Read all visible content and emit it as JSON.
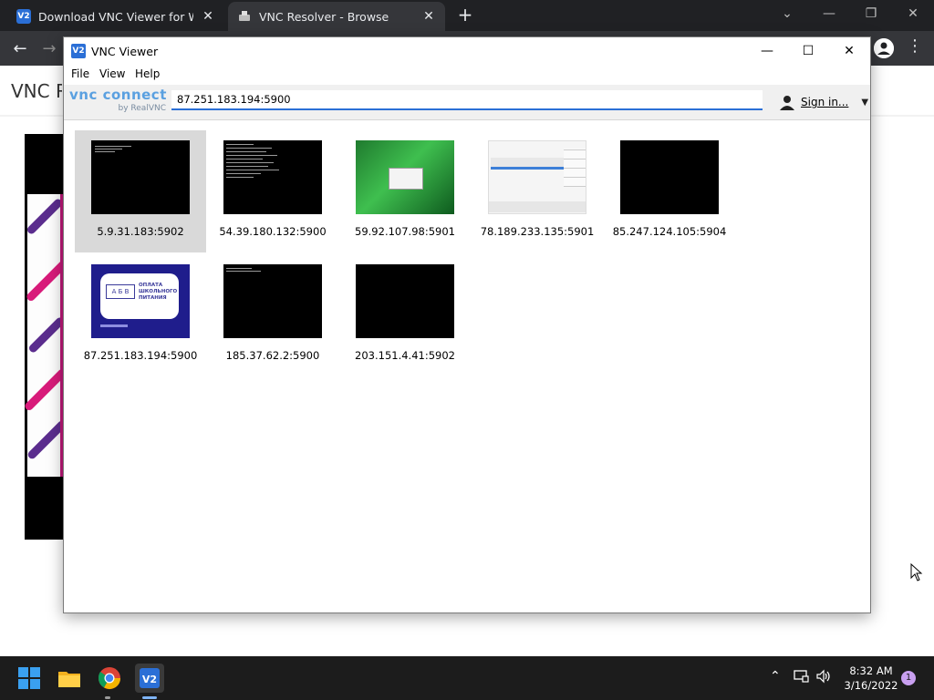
{
  "browser": {
    "tabs": [
      {
        "title": "Download VNC Viewer for Windows",
        "favicon": "vnc-icon",
        "active": false
      },
      {
        "title": "VNC Resolver - Browse",
        "favicon": "resolver-icon",
        "active": true
      }
    ],
    "page_heading": "VNC Resolver"
  },
  "vnc": {
    "window_title": "VNC Viewer",
    "menu": [
      "File",
      "View",
      "Help"
    ],
    "logo_main": "vnc connect",
    "logo_sub": "by RealVNC",
    "address": "87.251.183.194:5900",
    "sign_in": "Sign in...",
    "connections": [
      {
        "label": "5.9.31.183:5902",
        "thumb": "terminal-sparse",
        "selected": true
      },
      {
        "label": "54.39.180.132:5900",
        "thumb": "terminal-dense",
        "selected": false
      },
      {
        "label": "59.92.107.98:5901",
        "thumb": "green-desktop",
        "selected": false
      },
      {
        "label": "78.189.233.135:5901",
        "thumb": "keypad-app",
        "selected": false
      },
      {
        "label": "85.247.124.105:5904",
        "thumb": "black",
        "selected": false
      },
      {
        "label": "87.251.183.194:5900",
        "thumb": "kiosk",
        "selected": false
      },
      {
        "label": "185.37.62.2:5900",
        "thumb": "terminal-minimal",
        "selected": false
      },
      {
        "label": "203.151.4.41:5902",
        "thumb": "black",
        "selected": false
      }
    ],
    "kiosk_thumb": {
      "letters": "А Б В",
      "text": "ОПЛАТА ШКОЛЬНОГО ПИТАНИЯ"
    }
  },
  "taskbar": {
    "time": "8:32 AM",
    "date": "3/16/2022",
    "notifications": "1"
  }
}
